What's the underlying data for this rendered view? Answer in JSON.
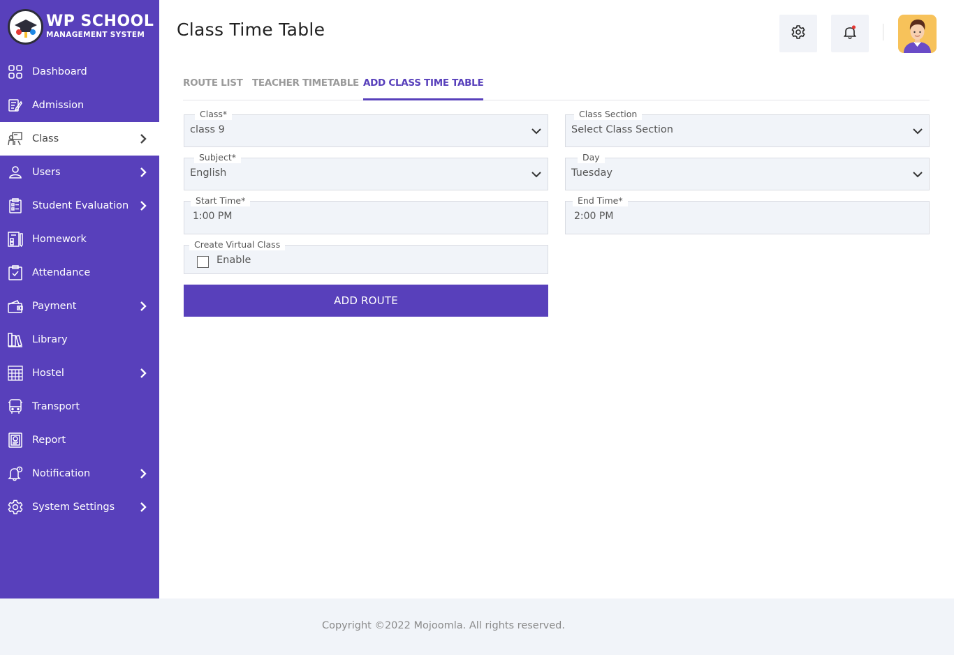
{
  "brand": {
    "title": "WP SCHOOL",
    "subtitle": "MANAGEMENT SYSTEM"
  },
  "sidebar": {
    "items": [
      {
        "label": "Dashboard",
        "icon": "dashboard-grid-icon",
        "has_submenu": false,
        "active": false
      },
      {
        "label": "Admission",
        "icon": "admission-form-icon",
        "has_submenu": false,
        "active": false
      },
      {
        "label": "Class",
        "icon": "class-teacher-icon",
        "has_submenu": true,
        "active": true
      },
      {
        "label": "Users",
        "icon": "user-icon",
        "has_submenu": true,
        "active": false
      },
      {
        "label": "Student Evaluation",
        "icon": "evaluation-clipboard-icon",
        "has_submenu": true,
        "active": false
      },
      {
        "label": "Homework",
        "icon": "homework-book-icon",
        "has_submenu": false,
        "active": false
      },
      {
        "label": "Attendance",
        "icon": "attendance-check-icon",
        "has_submenu": false,
        "active": false
      },
      {
        "label": "Payment",
        "icon": "wallet-icon",
        "has_submenu": true,
        "active": false
      },
      {
        "label": "Library",
        "icon": "library-books-icon",
        "has_submenu": false,
        "active": false
      },
      {
        "label": "Hostel",
        "icon": "hostel-building-icon",
        "has_submenu": true,
        "active": false
      },
      {
        "label": "Transport",
        "icon": "bus-icon",
        "has_submenu": false,
        "active": false
      },
      {
        "label": "Report",
        "icon": "report-icon",
        "has_submenu": false,
        "active": false
      },
      {
        "label": "Notification",
        "icon": "notification-bell-icon",
        "has_submenu": true,
        "active": false
      },
      {
        "label": "System Settings",
        "icon": "gear-icon",
        "has_submenu": true,
        "active": false
      }
    ]
  },
  "header": {
    "title": "Class Time Table"
  },
  "tabs": [
    {
      "label": "ROUTE LIST",
      "active": false
    },
    {
      "label": "TEACHER TIMETABLE",
      "active": false
    },
    {
      "label": "ADD CLASS TIME TABLE",
      "active": true
    }
  ],
  "form": {
    "class": {
      "legend": "Class*",
      "value": "class 9"
    },
    "class_section": {
      "legend": "Class Section",
      "value": "Select Class Section"
    },
    "subject": {
      "legend": "Subject*",
      "value": "English"
    },
    "day": {
      "legend": "Day",
      "value": "Tuesday"
    },
    "start_time": {
      "legend": "Start Time*",
      "value": "1:00 PM"
    },
    "end_time": {
      "legend": "End Time*",
      "value": "2:00 PM"
    },
    "virtual_class": {
      "legend": "Create Virtual Class",
      "checkbox_label": "Enable",
      "checked": false
    },
    "submit_label": "ADD ROUTE"
  },
  "footer": {
    "text": "Copyright ©2022 Mojoomla. All rights reserved."
  },
  "colors": {
    "primary": "#5840bb",
    "field_bg": "#f1f4f9",
    "notification_dot": "#e53935"
  }
}
